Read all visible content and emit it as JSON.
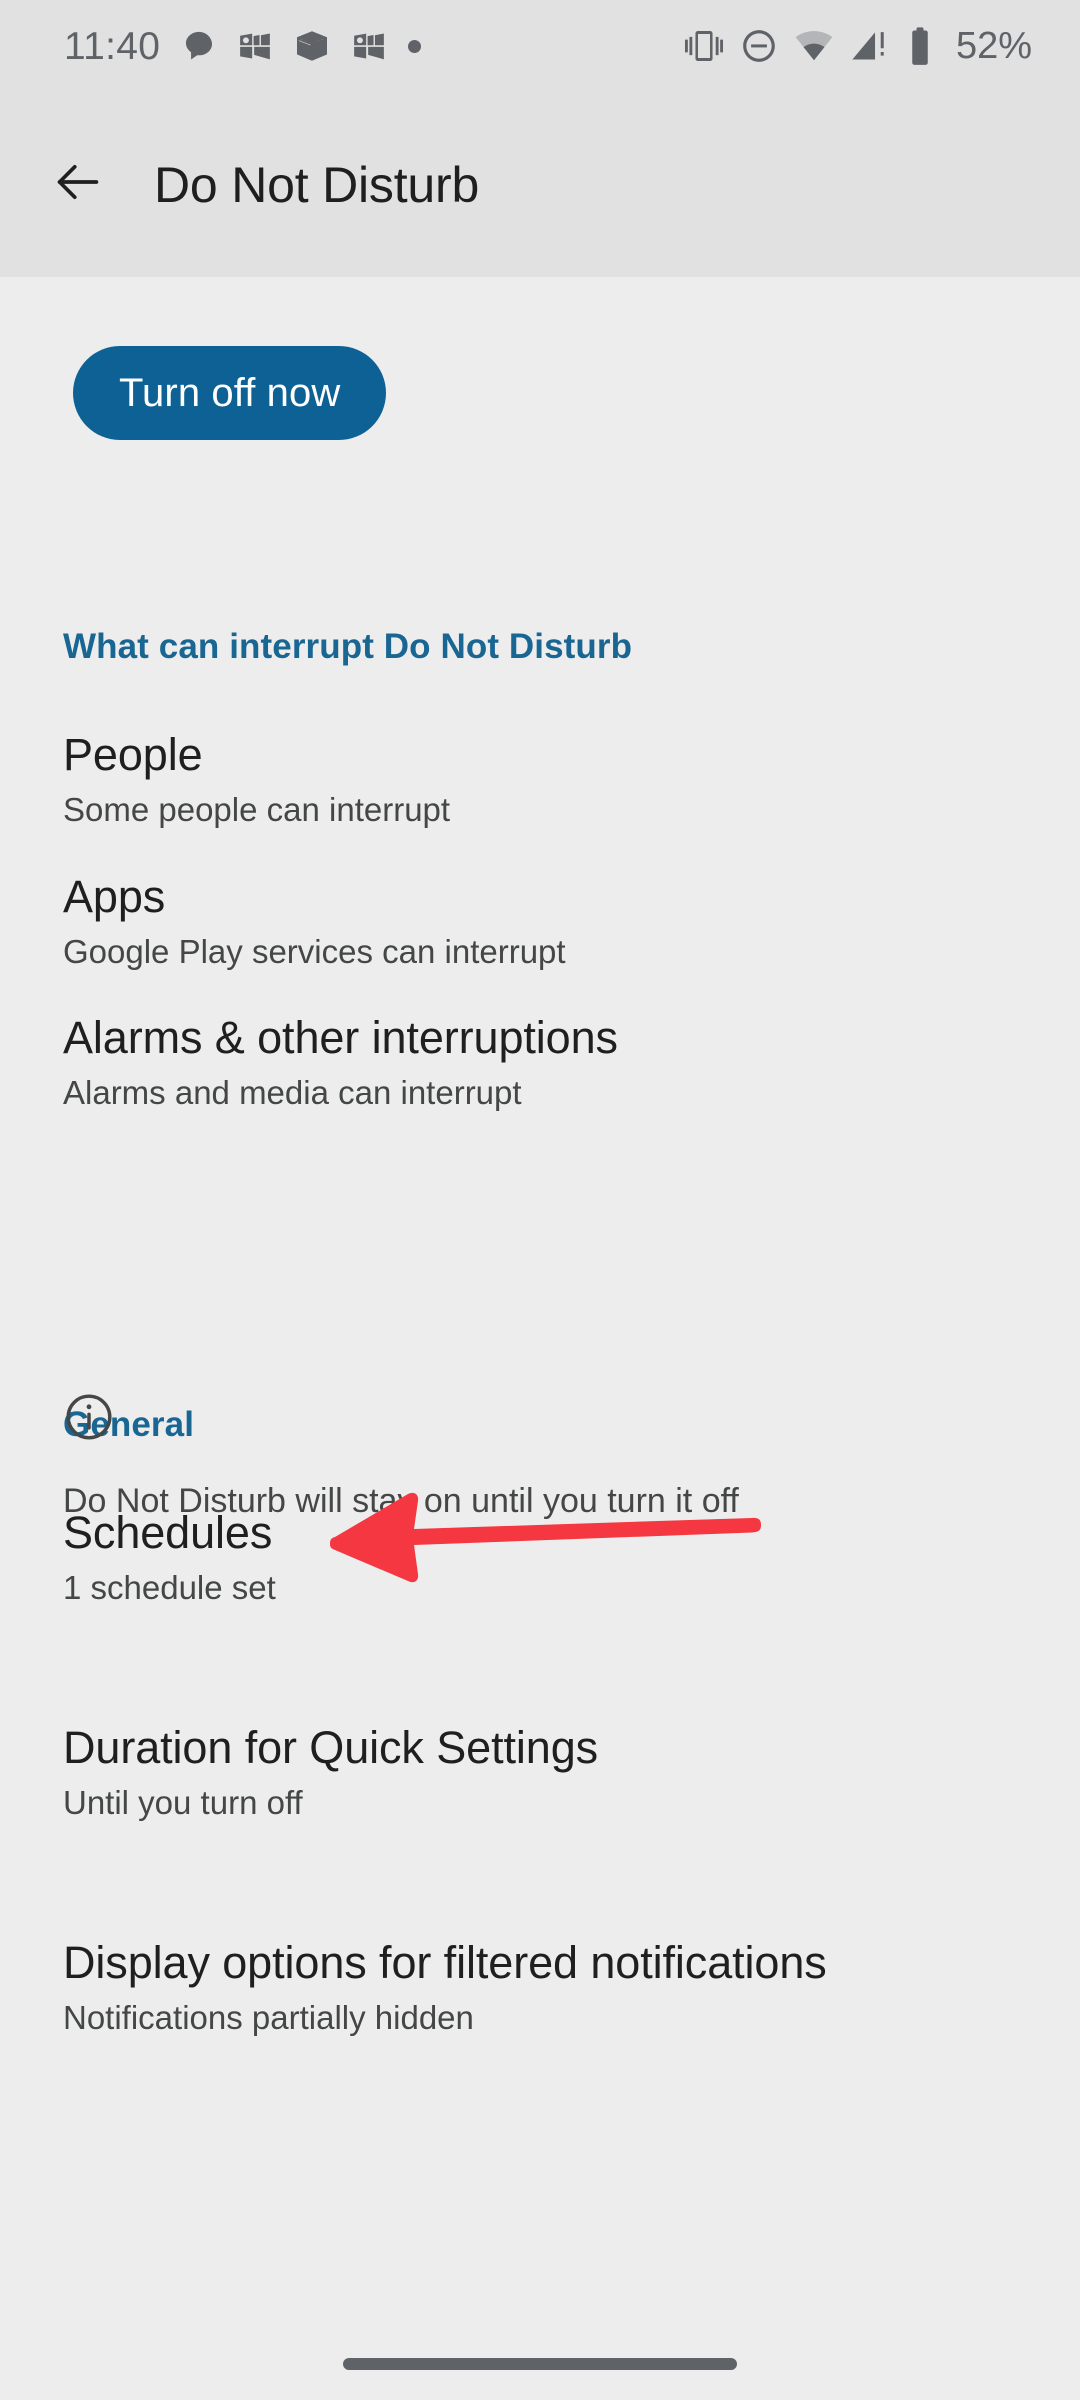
{
  "status_bar": {
    "time": "11:40",
    "left_icons": [
      "chat-bubble-icon",
      "outlook-icon",
      "package-box-icon",
      "outlook-icon",
      "dot-icon"
    ],
    "right_icons": [
      "vibrate-icon",
      "do-not-disturb-icon",
      "wifi-icon",
      "cellular-signal-alert-icon",
      "battery-icon"
    ],
    "battery_percent": "52%"
  },
  "app_bar": {
    "back_icon": "arrow-left-icon",
    "title": "Do Not Disturb"
  },
  "primary_action": {
    "label": "Turn off now"
  },
  "sections": [
    {
      "header": "What can interrupt Do Not Disturb",
      "items": [
        {
          "title": "People",
          "subtitle": "Some people can interrupt"
        },
        {
          "title": "Apps",
          "subtitle": "Google Play services can interrupt"
        },
        {
          "title": "Alarms & other interruptions",
          "subtitle": "Alarms and media can interrupt"
        }
      ]
    },
    {
      "header": "General",
      "items": [
        {
          "title": "Schedules",
          "subtitle": "1 schedule set"
        },
        {
          "title": "Duration for Quick Settings",
          "subtitle": "Until you turn off"
        },
        {
          "title": "Display options for filtered notifications",
          "subtitle": "Notifications partially hidden"
        }
      ]
    }
  ],
  "footer": {
    "icon": "info-circle-icon",
    "note": "Do Not Disturb will stay on until you turn it off"
  },
  "annotation": {
    "type": "arrow-left",
    "color": "#F43740",
    "points_to": "Schedules"
  },
  "nav_bar": {
    "home_indicator": "home-indicator-pill"
  },
  "colors": {
    "status_bar_bg": "#E1E1E1",
    "app_bar_bg": "#E1E1E1",
    "content_bg": "#EDEDED",
    "accent_blue": "#1A6693",
    "button_blue": "#0E6195",
    "title_text": "#1F1F1F",
    "subtitle_text": "#444746",
    "icon_gray": "#5F6368",
    "annotation_red": "#F43740"
  }
}
